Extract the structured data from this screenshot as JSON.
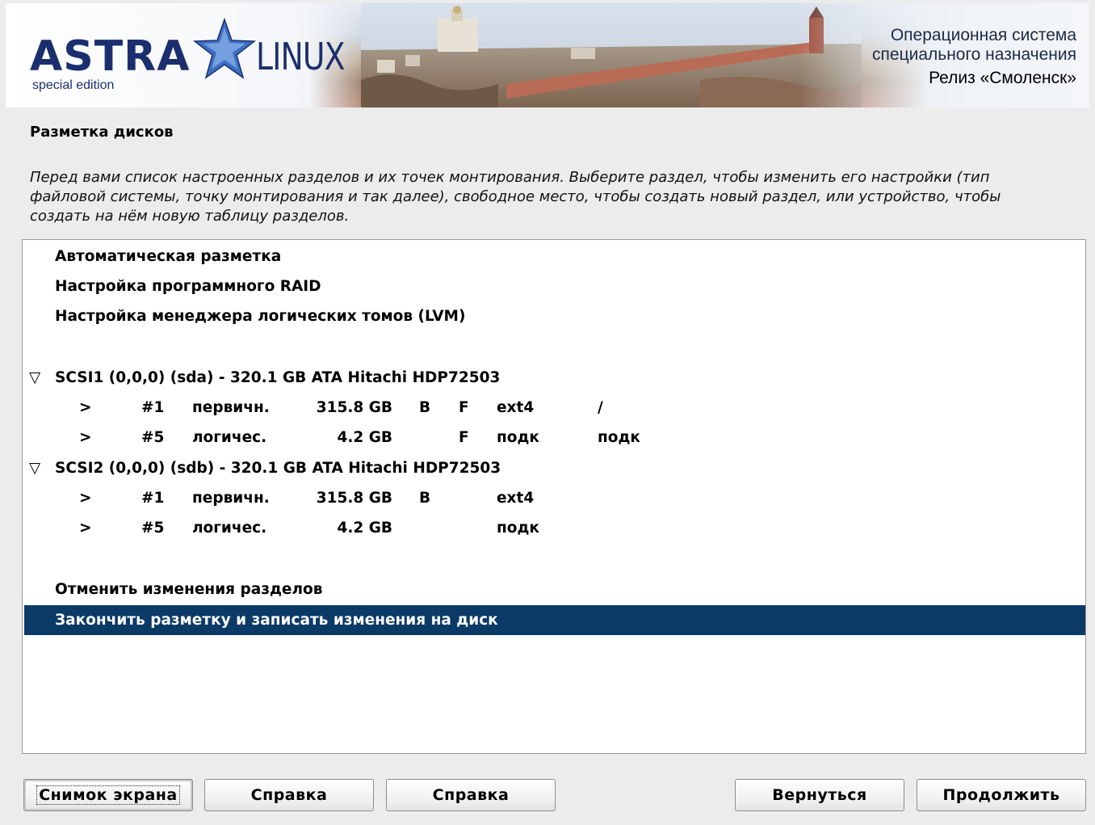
{
  "header": {
    "brand_left": "ASTRA",
    "brand_right": "LINUX",
    "edition": "special edition",
    "tagline_line1": "Операционная система",
    "tagline_line2": "специального назначения",
    "release": "Релиз «Смоленск»"
  },
  "page": {
    "title": "Разметка дисков",
    "description": "Перед вами список настроенных разделов и их точек монтирования. Выберите раздел, чтобы изменить его настройки (тип файловой системы, точку монтирования и так далее), свободное место, чтобы создать новый раздел, или устройство, чтобы создать на нём новую таблицу разделов."
  },
  "list": {
    "options": [
      "Автоматическая разметка",
      "Настройка программного RAID",
      "Настройка менеджера логических томов (LVM)"
    ],
    "disks": [
      {
        "label": "SCSI1 (0,0,0) (sda) - 320.1 GB ATA Hitachi HDP72503",
        "expander": "▽",
        "partitions": [
          {
            "arrow": ">",
            "num": "#1",
            "type": "первичн.",
            "size": "315.8 GB",
            "boot": "B",
            "format": "F",
            "fs": "ext4",
            "mount": "/"
          },
          {
            "arrow": ">",
            "num": "#5",
            "type": "логичес.",
            "size": "4.2 GB",
            "boot": "",
            "format": "F",
            "fs": "подк",
            "mount": "подк"
          }
        ]
      },
      {
        "label": "SCSI2 (0,0,0) (sdb) - 320.1 GB ATA Hitachi HDP72503",
        "expander": "▽",
        "partitions": [
          {
            "arrow": ">",
            "num": "#1",
            "type": "первичн.",
            "size": "315.8 GB",
            "boot": "B",
            "format": "",
            "fs": "ext4",
            "mount": ""
          },
          {
            "arrow": ">",
            "num": "#5",
            "type": "логичес.",
            "size": "4.2 GB",
            "boot": "",
            "format": "",
            "fs": "подк",
            "mount": ""
          }
        ]
      }
    ],
    "undo": "Отменить изменения разделов",
    "finish": "Закончить разметку и записать изменения на диск"
  },
  "buttons": {
    "screenshot": "Снимок экрана",
    "help1": "Справка",
    "help2": "Справка",
    "back": "Вернуться",
    "continue": "Продолжить"
  },
  "colors": {
    "selection": "#0b3a66",
    "brand": "#1b2f6e"
  }
}
